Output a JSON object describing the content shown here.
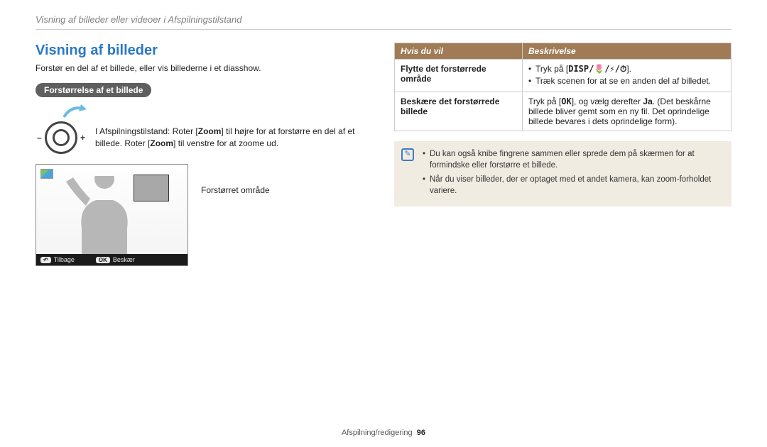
{
  "breadcrumb": "Visning af billeder eller videoer i Afspilningstilstand",
  "section_title": "Visning af billeder",
  "intro": "Forstør en del af et billede, eller vis billederne i et diasshow.",
  "pill": "Forstørrelse af et billede",
  "zoom_instructions_pre": "I Afspilningstilstand: Roter [",
  "zoom_word": "Zoom",
  "zoom_instructions_mid": "] til højre for at forstørre en del af et billede. Roter [",
  "zoom_instructions_post": "] til venstre for at zoome ud.",
  "thumb": {
    "caption": "Forstørret område",
    "back_key": "↶",
    "back_label": "Tilbage",
    "ok_key": "OK",
    "ok_label": "Beskær"
  },
  "table": {
    "head_left": "Hvis du vil",
    "head_right": "Beskrivelse",
    "row1_left": "Flytte det forstørrede område",
    "row1_item1_pre": "Tryk på [",
    "row1_item1_symbols": "DISP/🌷/⚡/⏱",
    "row1_item1_post": "].",
    "row1_item2": "Træk scenen for at se en anden del af billedet.",
    "row2_left": "Beskære det forstørrede billede",
    "row2_pre": "Tryk på [",
    "row2_ok": "OK",
    "row2_mid": "], og vælg derefter ",
    "row2_ja": "Ja",
    "row2_post": ". (Det beskårne billede bliver gemt som en ny fil. Det oprindelige billede bevares i dets oprindelige form).",
    "note_icon": "✎",
    "note1": "Du kan også knibe fingrene sammen eller sprede dem på skærmen for at formindske eller forstørre et billede.",
    "note2": "Når du viser billeder, der er optaget med et andet kamera, kan zoom-forholdet variere."
  },
  "footer": {
    "section": "Afspilning/redigering",
    "page": "96"
  }
}
